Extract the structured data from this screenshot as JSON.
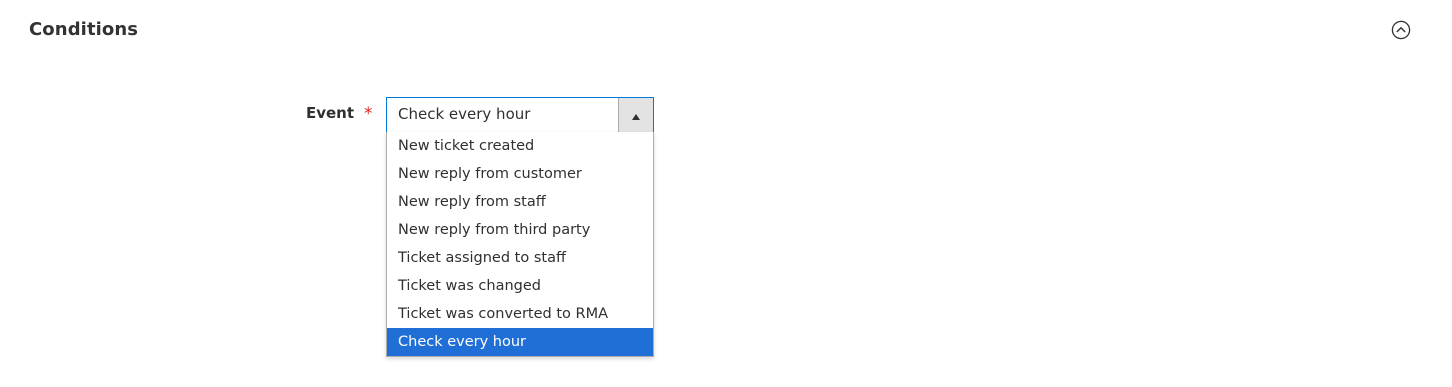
{
  "section": {
    "title": "Conditions",
    "toggle_icon": "chevron-up-circle-icon"
  },
  "event_field": {
    "label": "Event",
    "required_marker": "*",
    "selected_value": "Check every hour",
    "arrow_icon": "triangle-up-icon",
    "options": [
      "New ticket created",
      "New reply from customer",
      "New reply from staff",
      "New reply from third party",
      "Ticket assigned to staff",
      "Ticket was changed",
      "Ticket was converted to RMA",
      "Check every hour"
    ],
    "selected_index": 7
  },
  "colors": {
    "focus_border": "#007bdb",
    "selected_bg": "#1f6fd6",
    "required": "#e22626"
  }
}
